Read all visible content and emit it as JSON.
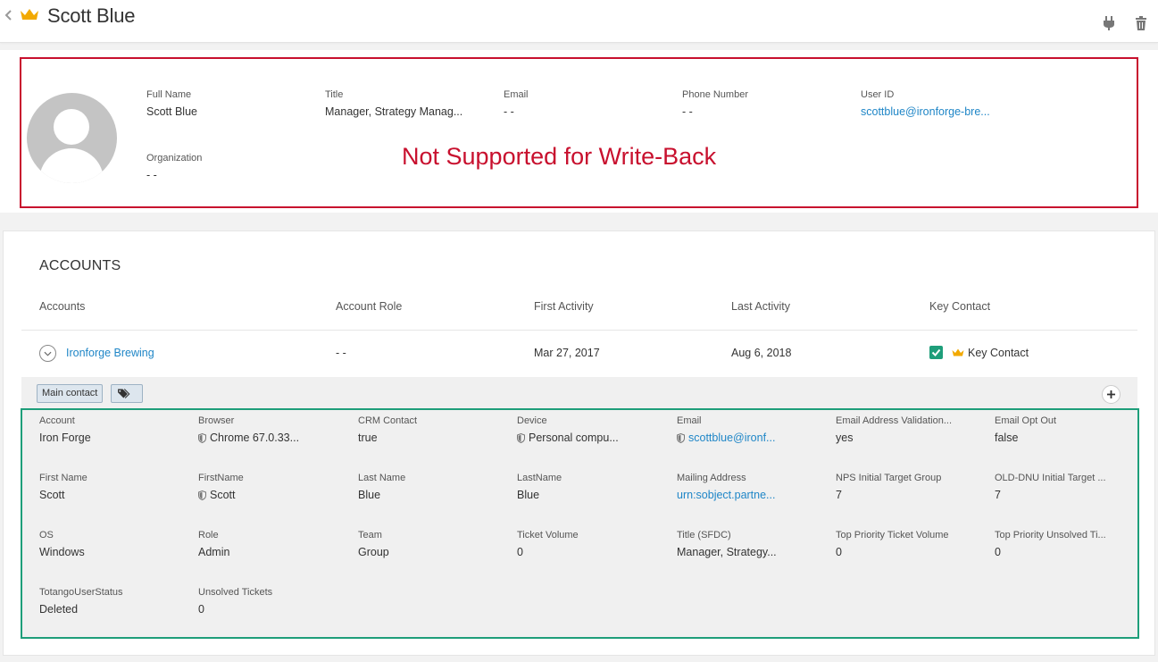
{
  "header": {
    "title": "Scott Blue",
    "icons": [
      "back-chevron-icon",
      "crown-icon",
      "plug-icon",
      "trash-icon"
    ]
  },
  "profile": {
    "fields": {
      "full_name": {
        "label": "Full Name",
        "value": "Scott Blue"
      },
      "title": {
        "label": "Title",
        "value": "Manager, Strategy Manag..."
      },
      "email": {
        "label": "Email",
        "value": "- -"
      },
      "phone": {
        "label": "Phone Number",
        "value": "- -"
      },
      "user_id": {
        "label": "User ID",
        "value": "scottblue@ironforge-bre..."
      },
      "organization": {
        "label": "Organization",
        "value": "- -"
      }
    },
    "notice": "Not Supported for Write-Back"
  },
  "accounts": {
    "title": "ACCOUNTS",
    "columns": [
      "Accounts",
      "Account Role",
      "First Activity",
      "Last Activity",
      "Key Contact"
    ],
    "row": {
      "account": "Ironforge Brewing",
      "role": "- -",
      "first_activity": "Mar 27, 2017",
      "last_activity": "Aug 6, 2018",
      "key_contact_checked": true,
      "key_contact_label": "Key Contact"
    },
    "tag_label": "Main contact",
    "details": [
      {
        "label": "Account",
        "value": "Iron Forge"
      },
      {
        "label": "Browser",
        "value": "Chrome 67.0.33...",
        "shield": true
      },
      {
        "label": "CRM Contact",
        "value": "true"
      },
      {
        "label": "Device",
        "value": "Personal compu...",
        "shield": true
      },
      {
        "label": "Email",
        "value": "scottblue@ironf...",
        "shield": true,
        "link": true
      },
      {
        "label": "Email Address Validation...",
        "value": "yes"
      },
      {
        "label": "Email Opt Out",
        "value": "false"
      },
      {
        "label": "First Name",
        "value": "Scott"
      },
      {
        "label": "FirstName",
        "value": "Scott",
        "shield": true
      },
      {
        "label": "Last Name",
        "value": "Blue"
      },
      {
        "label": "LastName",
        "value": "Blue"
      },
      {
        "label": "Mailing Address",
        "value": "urn:sobject.partne...",
        "link": true
      },
      {
        "label": "NPS Initial Target Group",
        "value": "7"
      },
      {
        "label": "OLD-DNU Initial Target ...",
        "value": "7"
      },
      {
        "label": "OS",
        "value": "Windows"
      },
      {
        "label": "Role",
        "value": "Admin"
      },
      {
        "label": "Team",
        "value": "Group"
      },
      {
        "label": "Ticket Volume",
        "value": "0"
      },
      {
        "label": "Title (SFDC)",
        "value": "Manager, Strategy..."
      },
      {
        "label": "Top Priority Ticket Volume",
        "value": "0"
      },
      {
        "label": "Top Priority Unsolved Ti...",
        "value": "0"
      },
      {
        "label": "TotangoUserStatus",
        "value": "Deleted"
      },
      {
        "label": "Unsolved Tickets",
        "value": "0"
      }
    ]
  },
  "colors": {
    "accent_red": "#c8102e",
    "accent_green": "#1e9e7a",
    "link_blue": "#1f86c7",
    "crown_gold": "#f2a900"
  }
}
